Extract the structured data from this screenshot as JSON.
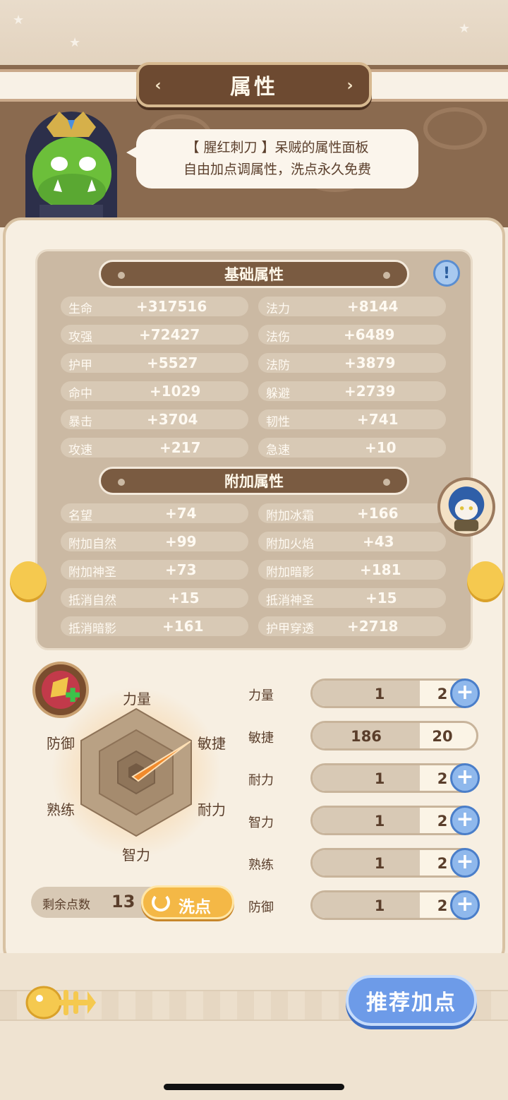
{
  "header": {
    "title": "属性"
  },
  "intro": {
    "line1": "【 腥红刺刀 】呆贼的属性面板",
    "line2": "自由加点调属性，洗点永久免费"
  },
  "base_section": {
    "title": "基础属性",
    "stats": [
      {
        "label": "生命",
        "value": "+317516"
      },
      {
        "label": "法力",
        "value": "+8144"
      },
      {
        "label": "攻强",
        "value": "+72427"
      },
      {
        "label": "法伤",
        "value": "+6489"
      },
      {
        "label": "护甲",
        "value": "+5527"
      },
      {
        "label": "法防",
        "value": "+3879"
      },
      {
        "label": "命中",
        "value": "+1029"
      },
      {
        "label": "躲避",
        "value": "+2739"
      },
      {
        "label": "暴击",
        "value": "+3704"
      },
      {
        "label": "韧性",
        "value": "+741"
      },
      {
        "label": "攻速",
        "value": "+217"
      },
      {
        "label": "急速",
        "value": "+10"
      }
    ]
  },
  "extra_section": {
    "title": "附加属性",
    "stats": [
      {
        "label": "名望",
        "value": "+74"
      },
      {
        "label": "附加冰霜",
        "value": "+166"
      },
      {
        "label": "附加自然",
        "value": "+99"
      },
      {
        "label": "附加火焰",
        "value": "+43"
      },
      {
        "label": "附加神圣",
        "value": "+73"
      },
      {
        "label": "附加暗影",
        "value": "+181"
      },
      {
        "label": "抵消自然",
        "value": "+15"
      },
      {
        "label": "抵消神圣",
        "value": "+15"
      },
      {
        "label": "抵消暗影",
        "value": "+161"
      },
      {
        "label": "护甲穿透",
        "value": "+2718"
      }
    ]
  },
  "radar": {
    "labels": {
      "top": "力量",
      "top_right": "敏捷",
      "bottom_right": "耐力",
      "bottom": "智力",
      "bottom_left": "熟练",
      "top_left": "防御"
    }
  },
  "points": {
    "remaining_label": "剩余点数",
    "remaining": "13",
    "reset_label": "洗点"
  },
  "attributes": [
    {
      "name": "力量",
      "base": "1",
      "add": "2",
      "plus": true
    },
    {
      "name": "敏捷",
      "base": "186",
      "add": "20",
      "plus": false
    },
    {
      "name": "耐力",
      "base": "1",
      "add": "2",
      "plus": true
    },
    {
      "name": "智力",
      "base": "1",
      "add": "2",
      "plus": true
    },
    {
      "name": "熟练",
      "base": "1",
      "add": "2",
      "plus": true
    },
    {
      "name": "防御",
      "base": "1",
      "add": "2",
      "plus": true
    }
  ],
  "recommend_label": "推荐加点",
  "info_icon": "exclamation-icon",
  "colors": {
    "accent_orange": "#f08a2c",
    "plus_blue": "#4a7ec9"
  }
}
